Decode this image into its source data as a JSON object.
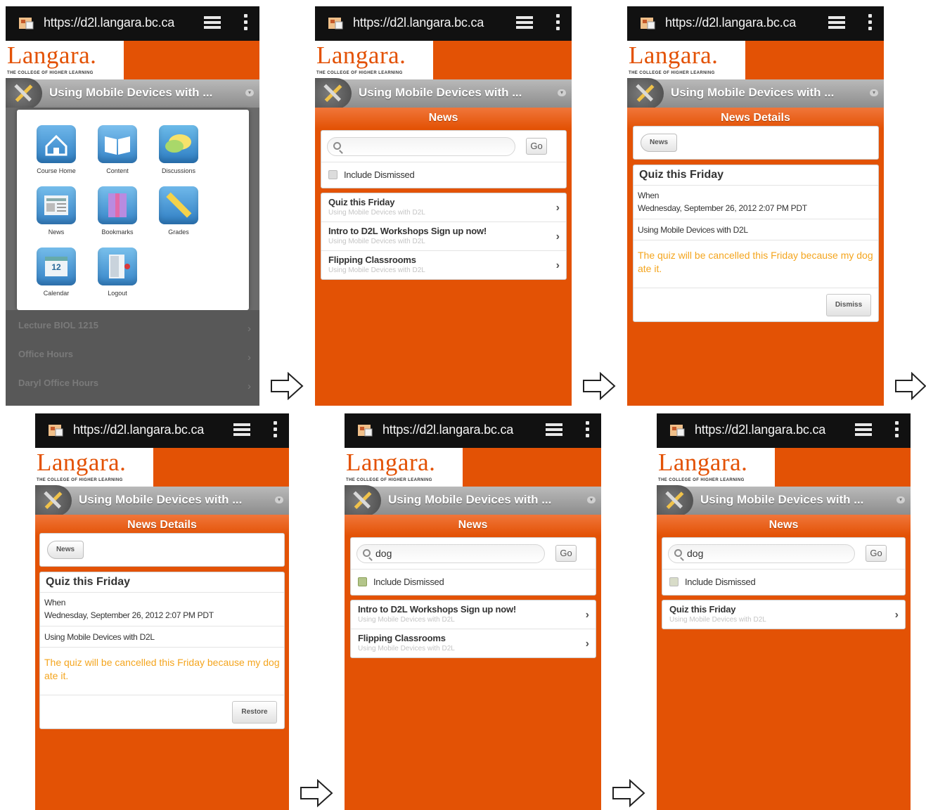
{
  "browser": {
    "url": "https://d2l.langara.bc.ca"
  },
  "brand": {
    "logo": "Langara.",
    "tagline": "THE COLLEGE OF HIGHER LEARNING"
  },
  "course_selector": {
    "title": "Using Mobile Devices with ..."
  },
  "home_menu": {
    "tiles": [
      {
        "label": "Course Home",
        "icon": "home-icon"
      },
      {
        "label": "Content",
        "icon": "book-icon"
      },
      {
        "label": "Discussions",
        "icon": "speech-bubble-icon"
      },
      {
        "label": "News",
        "icon": "newspaper-icon"
      },
      {
        "label": "Bookmarks",
        "icon": "bookmark-icon"
      },
      {
        "label": "Grades",
        "icon": "ruler-icon"
      },
      {
        "label": "Calendar",
        "icon": "calendar-icon"
      },
      {
        "label": "Logout",
        "icon": "door-icon"
      }
    ],
    "calendar_day": "12",
    "background_items": [
      "Lecture BIOL 1215",
      "Office Hours",
      "Daryl Office Hours"
    ]
  },
  "news": {
    "heading": "News",
    "go_label": "Go",
    "include_dismissed_label": "Include Dismissed",
    "search_query": "dog",
    "course_name": "Using Mobile Devices with D2L",
    "items_all": [
      "Quiz this Friday",
      "Intro to D2L Workshops Sign up now!",
      "Flipping Classrooms"
    ],
    "items_search_default": [
      "Intro to D2L Workshops Sign up now!",
      "Flipping Classrooms"
    ],
    "items_search_dismissed": [
      "Quiz this Friday"
    ]
  },
  "news_details": {
    "heading": "News Details",
    "back_label": "News",
    "title": "Quiz this Friday",
    "when_label": "When",
    "when_value": "Wednesday, September 26, 2012 2:07 PM PDT",
    "course": "Using Mobile Devices with D2L",
    "body": "The quiz will be cancelled this Friday because my dog ate it.",
    "dismiss_label": "Dismiss",
    "restore_label": "Restore"
  },
  "colors": {
    "accent": "#e35205",
    "body_text_highlight": "#f4a51e",
    "url_bar": "#111111"
  }
}
